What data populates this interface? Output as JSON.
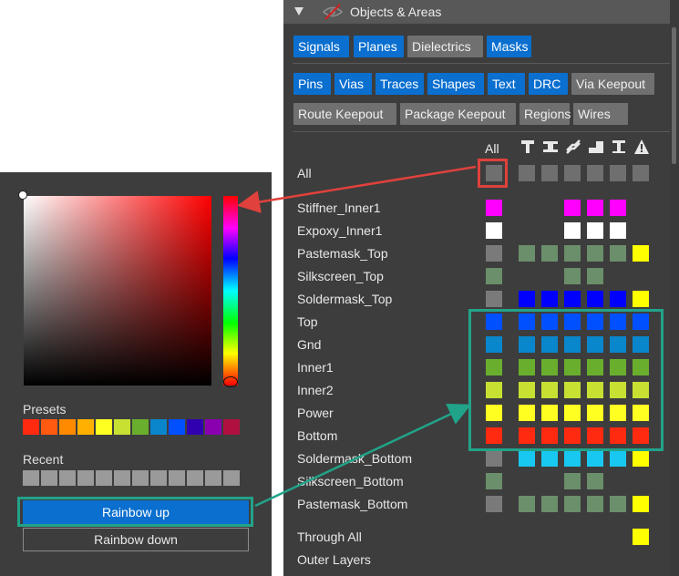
{
  "header": {
    "title": "Objects & Areas"
  },
  "filters": {
    "row1": [
      {
        "label": "Signals",
        "on": true
      },
      {
        "label": "Planes",
        "on": true
      },
      {
        "label": "Dielectrics",
        "on": false
      },
      {
        "label": "Masks",
        "on": true
      }
    ],
    "row2": [
      {
        "label": "Pins",
        "on": true
      },
      {
        "label": "Vias",
        "on": true
      },
      {
        "label": "Traces",
        "on": true
      },
      {
        "label": "Shapes",
        "on": true
      },
      {
        "label": "Text",
        "on": true
      },
      {
        "label": "DRC",
        "on": true
      },
      {
        "label": "Via Keepout",
        "on": false
      }
    ],
    "row3": [
      {
        "label": "Route Keepout",
        "on": false
      },
      {
        "label": "Package Keepout",
        "on": false
      },
      {
        "label": "Regions",
        "on": false
      },
      {
        "label": "Wires",
        "on": false
      }
    ]
  },
  "columns": {
    "all_label": "All",
    "icons": [
      "pin-icon",
      "via-icon",
      "trace-icon",
      "shape-icon",
      "text-icon",
      "drc-warning-icon"
    ]
  },
  "layers": [
    {
      "name": "All",
      "all": "#6f6f6f",
      "cells": [
        "#6f6f6f",
        "#6f6f6f",
        "#6f6f6f",
        "#6f6f6f",
        "#6f6f6f",
        "#6f6f6f"
      ]
    },
    {
      "name": "Stiffner_Inner1",
      "all": "#ff00ff",
      "cells": [
        null,
        null,
        "#ff00ff",
        "#ff00ff",
        "#ff00ff",
        null
      ]
    },
    {
      "name": "Expoxy_Inner1",
      "all": "#ffffff",
      "cells": [
        null,
        null,
        "#ffffff",
        "#ffffff",
        "#ffffff",
        null
      ]
    },
    {
      "name": "Pastemask_Top",
      "all": "#7a7a7a",
      "cells": [
        "#6b8e6b",
        "#6b8e6b",
        "#6b8e6b",
        "#6b8e6b",
        "#6b8e6b",
        "#ffff00"
      ]
    },
    {
      "name": "Silkscreen_Top",
      "all": "#6b8e6b",
      "cells": [
        null,
        null,
        "#6b8e6b",
        "#6b8e6b",
        null,
        null
      ]
    },
    {
      "name": "Soldermask_Top",
      "all": "#7a7a7a",
      "cells": [
        "#0000ff",
        "#0000ff",
        "#0000ff",
        "#0000ff",
        "#0000ff",
        "#ffff00"
      ]
    },
    {
      "name": "Top",
      "all": "#0050ff",
      "cells": [
        "#0050ff",
        "#0050ff",
        "#0050ff",
        "#0050ff",
        "#0050ff",
        "#0050ff"
      ]
    },
    {
      "name": "Gnd",
      "all": "#0a86cc",
      "cells": [
        "#0a86cc",
        "#0a86cc",
        "#0a86cc",
        "#0a86cc",
        "#0a86cc",
        "#0a86cc"
      ]
    },
    {
      "name": "Inner1",
      "all": "#6aae2e",
      "cells": [
        "#6aae2e",
        "#6aae2e",
        "#6aae2e",
        "#6aae2e",
        "#6aae2e",
        "#6aae2e"
      ]
    },
    {
      "name": "Inner2",
      "all": "#c8e032",
      "cells": [
        "#c8e032",
        "#c8e032",
        "#c8e032",
        "#c8e032",
        "#c8e032",
        "#c8e032"
      ]
    },
    {
      "name": "Power",
      "all": "#ffff22",
      "cells": [
        "#ffff22",
        "#ffff22",
        "#ffff22",
        "#ffff22",
        "#ffff22",
        "#ffff22"
      ]
    },
    {
      "name": "Bottom",
      "all": "#ff2a10",
      "cells": [
        "#ff2a10",
        "#ff2a10",
        "#ff2a10",
        "#ff2a10",
        "#ff2a10",
        "#ff2a10"
      ]
    },
    {
      "name": "Soldermask_Bottom",
      "all": "#7a7a7a",
      "cells": [
        "#18c8f0",
        "#18c8f0",
        "#18c8f0",
        "#18c8f0",
        "#18c8f0",
        "#ffff00"
      ]
    },
    {
      "name": "Silkscreen_Bottom",
      "all": "#6b8e6b",
      "cells": [
        null,
        null,
        "#6b8e6b",
        "#6b8e6b",
        null,
        null
      ]
    },
    {
      "name": "Pastemask_Bottom",
      "all": "#7a7a7a",
      "cells": [
        "#6b8e6b",
        "#6b8e6b",
        "#6b8e6b",
        "#6b8e6b",
        "#6b8e6b",
        "#ffff00"
      ]
    },
    {
      "name": "Through All",
      "all": null,
      "cells": [
        null,
        null,
        null,
        null,
        null,
        "#ffff00"
      ]
    },
    {
      "name": "Outer Layers",
      "all": null,
      "cells": [
        null,
        null,
        null,
        null,
        null,
        null
      ]
    }
  ],
  "color_picker": {
    "presets_label": "Presets",
    "recent_label": "Recent",
    "presets": [
      "#ff2a10",
      "#ff5a10",
      "#ff8a00",
      "#ffb000",
      "#ffff22",
      "#c8e032",
      "#6aae2e",
      "#0a86cc",
      "#0050ff",
      "#3000b0",
      "#8a00b0",
      "#b01040"
    ],
    "recent_count": 12,
    "rainbow_up_label": "Rainbow up",
    "rainbow_down_label": "Rainbow down"
  }
}
